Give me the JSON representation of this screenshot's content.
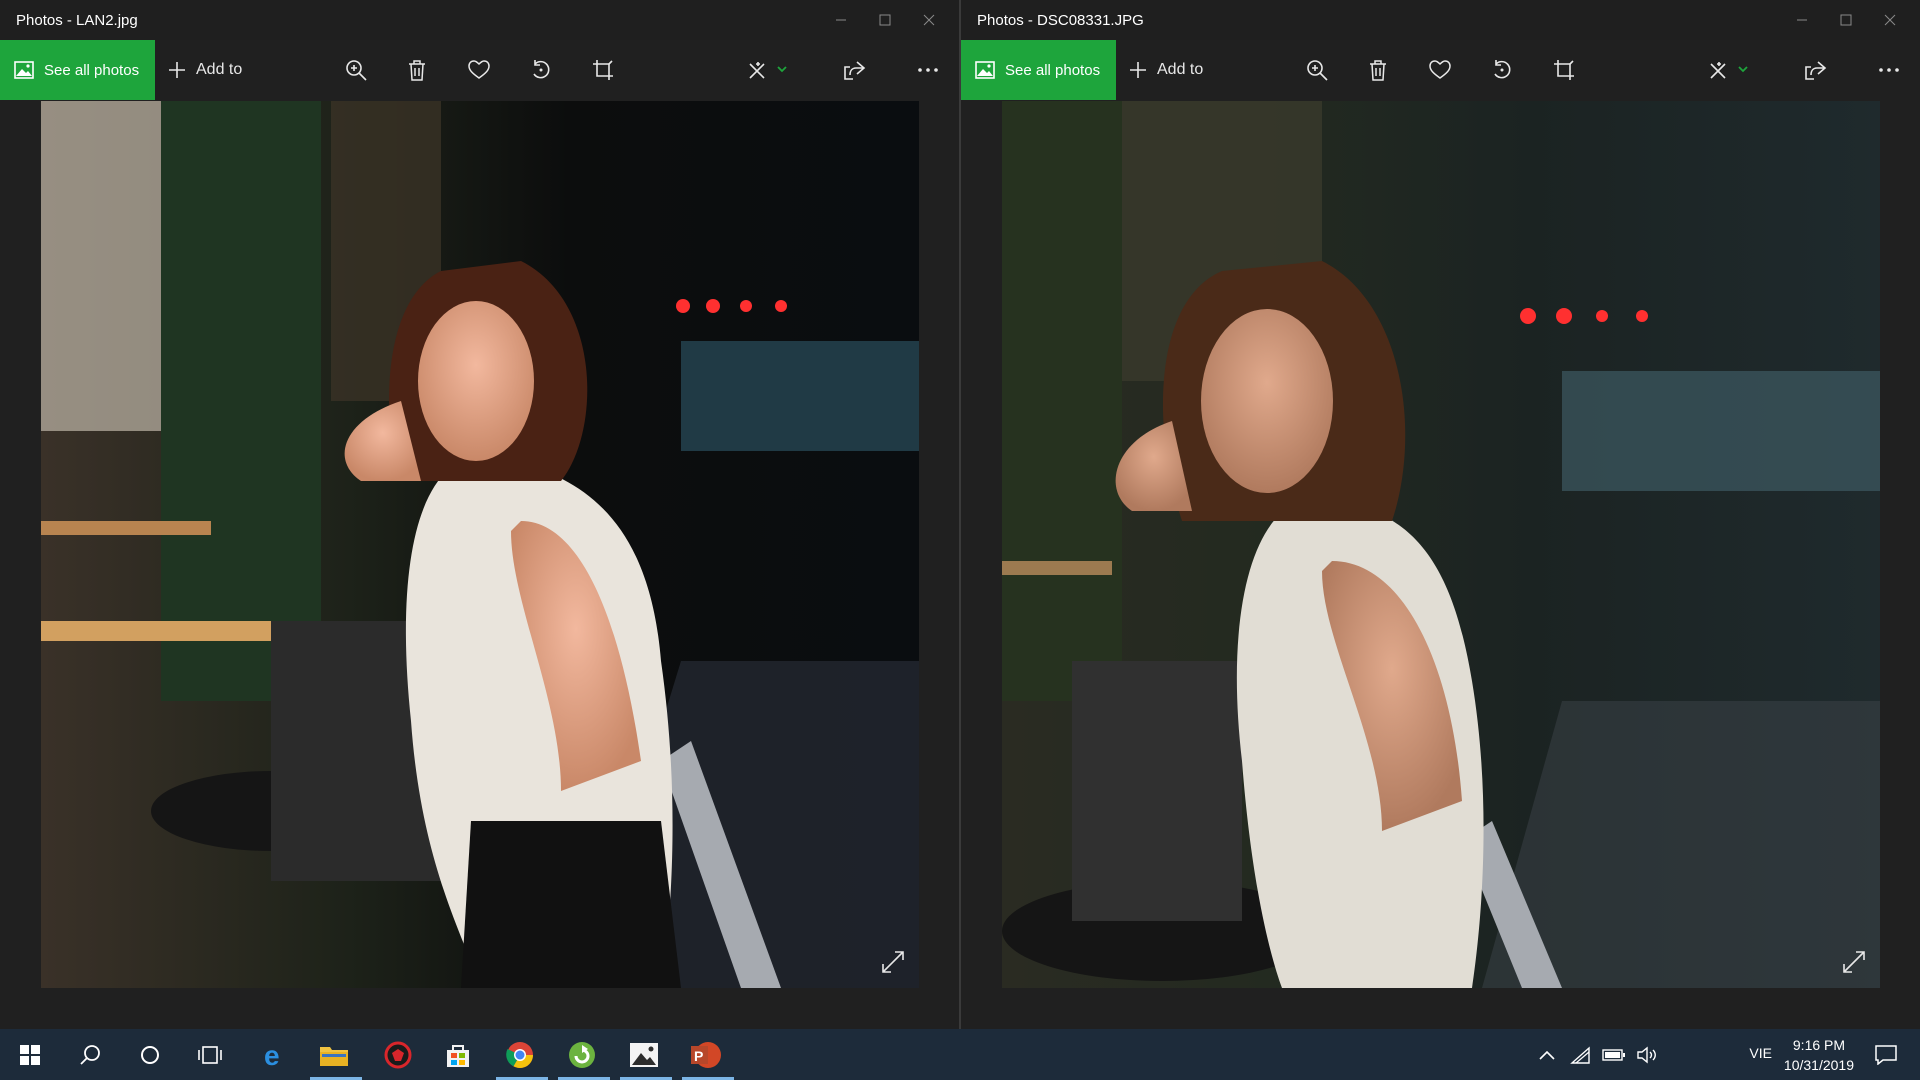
{
  "windows": [
    {
      "title": "Photos - LAN2.jpg",
      "see_all_label": "See all photos",
      "add_to_label": "Add to"
    },
    {
      "title": "Photos - DSC08331.JPG",
      "see_all_label": "See all photos",
      "add_to_label": "Add to"
    }
  ],
  "toolbar_icons": [
    "zoom-in-icon",
    "delete-icon",
    "favorite-icon",
    "rotate-icon",
    "crop-icon",
    "edit-enhance-icon",
    "share-icon",
    "more-icon"
  ],
  "taskbar": {
    "apps": [
      "start-icon",
      "search-icon",
      "cortana-icon",
      "task-view-icon",
      "edge-icon",
      "file-explorer-icon",
      "app-red-icon",
      "store-icon",
      "chrome-icon",
      "app-green-icon",
      "photos-icon",
      "powerpoint-icon"
    ],
    "language": "VIE",
    "time": "9:16 PM",
    "date": "10/31/2019"
  },
  "colors": {
    "accent_green": "#1ea53c",
    "taskbar_bg": "#1d2b3a",
    "window_bg": "#202020"
  }
}
